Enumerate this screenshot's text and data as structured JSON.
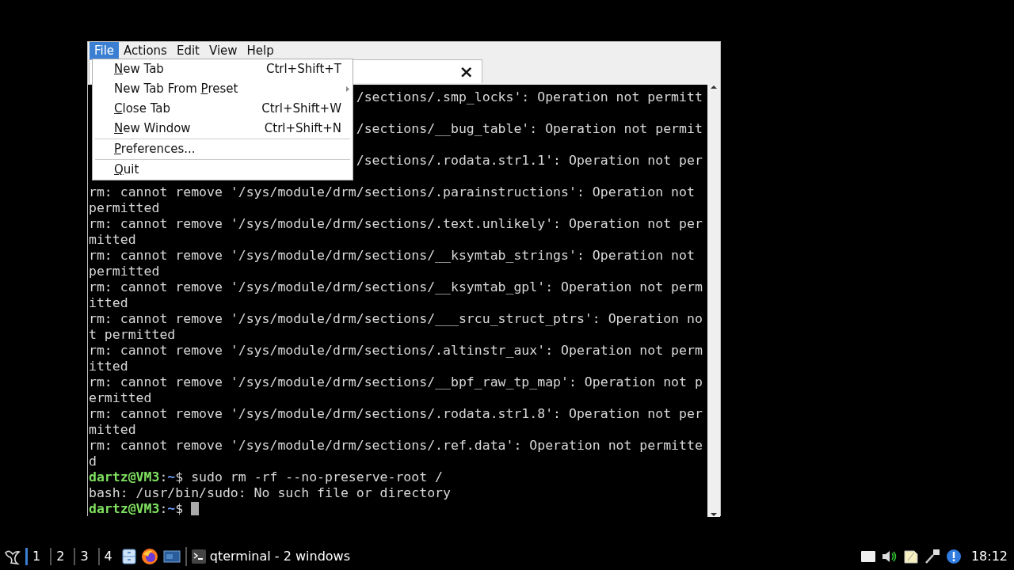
{
  "menubar": [
    {
      "label": "File",
      "selected": true
    },
    {
      "label": "Actions",
      "selected": false
    },
    {
      "label": "Edit",
      "selected": false
    },
    {
      "label": "View",
      "selected": false
    },
    {
      "label": "Help",
      "selected": false
    }
  ],
  "file_menu": [
    {
      "kind": "item",
      "mnemonic": "N",
      "after": "ew Tab",
      "shortcut": "Ctrl+Shift+T"
    },
    {
      "kind": "submenu",
      "before": "New Tab From ",
      "mnemonic": "P",
      "after": "reset"
    },
    {
      "kind": "item",
      "mnemonic": "C",
      "after": "lose Tab",
      "shortcut": "Ctrl+Shift+W"
    },
    {
      "kind": "item",
      "mnemonic": "N",
      "after": "ew Window",
      "shortcut": "Ctrl+Shift+N"
    },
    {
      "kind": "separator"
    },
    {
      "kind": "item",
      "mnemonic": "P",
      "after": "references..."
    },
    {
      "kind": "separator"
    },
    {
      "kind": "item",
      "mnemonic": "Q",
      "after": "uit"
    }
  ],
  "tab": {
    "close": "×"
  },
  "terminal_rows": [
    {
      "kind": "partial",
      "text": "/sections/.smp_locks': Operation not permitt"
    },
    {
      "kind": "hidden"
    },
    {
      "kind": "partial",
      "text": "/sections/__bug_table': Operation not permit"
    },
    {
      "kind": "hidden"
    },
    {
      "kind": "partial",
      "text": "/sections/.rodata.str1.1': Operation not per"
    },
    {
      "kind": "hidden"
    },
    {
      "kind": "output",
      "text": "rm: cannot remove '/sys/module/drm/sections/.parainstructions': Operation not"
    },
    {
      "kind": "output",
      "text": "permitted"
    },
    {
      "kind": "output",
      "text": "rm: cannot remove '/sys/module/drm/sections/.text.unlikely': Operation not per"
    },
    {
      "kind": "output",
      "text": "mitted"
    },
    {
      "kind": "output",
      "text": "rm: cannot remove '/sys/module/drm/sections/__ksymtab_strings': Operation not"
    },
    {
      "kind": "output",
      "text": "permitted"
    },
    {
      "kind": "output",
      "text": "rm: cannot remove '/sys/module/drm/sections/__ksymtab_gpl': Operation not perm"
    },
    {
      "kind": "output",
      "text": "itted"
    },
    {
      "kind": "output",
      "text": "rm: cannot remove '/sys/module/drm/sections/___srcu_struct_ptrs': Operation no"
    },
    {
      "kind": "output",
      "text": "t permitted"
    },
    {
      "kind": "output",
      "text": "rm: cannot remove '/sys/module/drm/sections/.altinstr_aux': Operation not perm"
    },
    {
      "kind": "output",
      "text": "itted"
    },
    {
      "kind": "output",
      "text": "rm: cannot remove '/sys/module/drm/sections/__bpf_raw_tp_map': Operation not p"
    },
    {
      "kind": "output",
      "text": "ermitted"
    },
    {
      "kind": "output",
      "text": "rm: cannot remove '/sys/module/drm/sections/.rodata.str1.8': Operation not per"
    },
    {
      "kind": "output",
      "text": "mitted"
    },
    {
      "kind": "output",
      "text": "rm: cannot remove '/sys/module/drm/sections/.ref.data': Operation not permitte"
    },
    {
      "kind": "output",
      "text": "d"
    },
    {
      "kind": "prompt",
      "user": "dartz@VM3",
      "sep": ":",
      "path": "~",
      "sign": "$",
      "command": "sudo rm -rf --no-preserve-root /"
    },
    {
      "kind": "output",
      "text": "bash: /usr/bin/sudo: No such file or directory"
    },
    {
      "kind": "prompt",
      "user": "dartz@VM3",
      "sep": ":",
      "path": "~",
      "sign": "$",
      "cursor": true
    }
  ],
  "taskbar": {
    "workspaces": [
      {
        "label": "1",
        "selected": true
      },
      {
        "label": "2",
        "selected": false
      },
      {
        "label": "3",
        "selected": false
      },
      {
        "label": "4",
        "selected": false
      }
    ],
    "task": "qterminal - 2 windows",
    "clock": "18:12"
  }
}
